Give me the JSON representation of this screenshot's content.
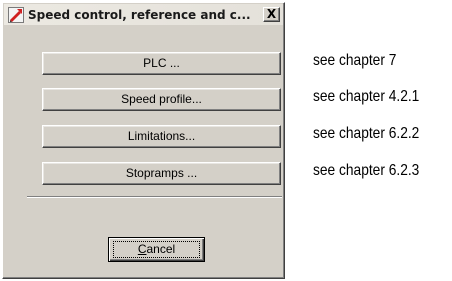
{
  "window": {
    "title": "Speed control, reference and c...",
    "close_label": "X"
  },
  "buttons": [
    {
      "label": "PLC ..."
    },
    {
      "label": "Speed profile..."
    },
    {
      "label": "Limitations..."
    },
    {
      "label": "Stopramps ..."
    }
  ],
  "cancel": {
    "mnemonic": "C",
    "rest": "ancel"
  },
  "notes": [
    {
      "text": "see chapter 7"
    },
    {
      "text": "see chapter 4.2.1"
    },
    {
      "text": "see chapter 6.2.2"
    },
    {
      "text": "see chapter 6.2.3"
    }
  ],
  "icons": {
    "app": "app-icon",
    "close": "close-icon"
  }
}
